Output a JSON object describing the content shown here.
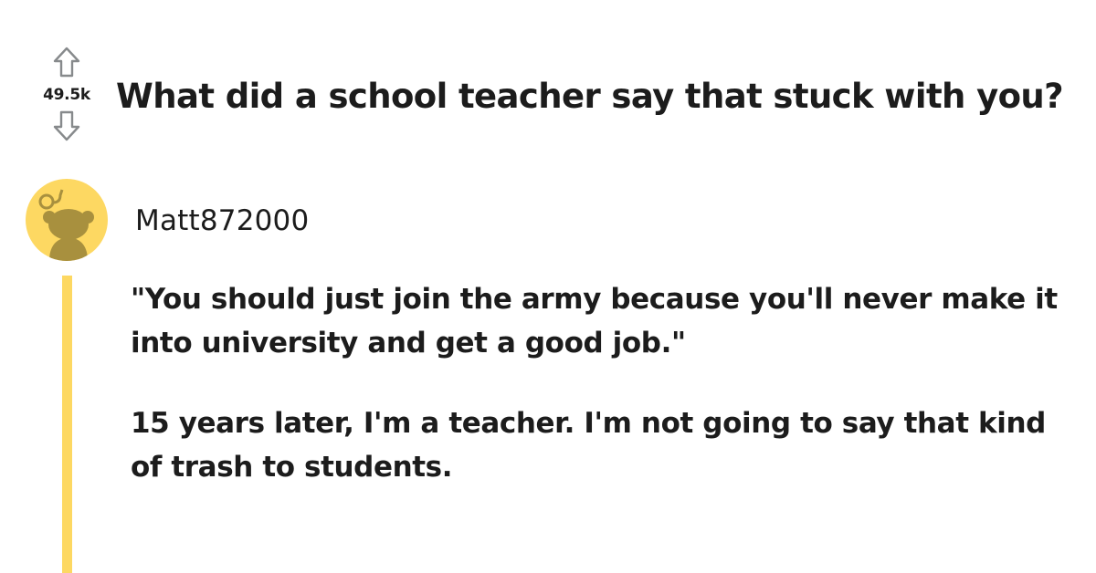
{
  "post": {
    "vote_count": "49.5k",
    "title": "What did a school teacher say that stuck with you?"
  },
  "comment": {
    "username": "Matt872000",
    "paragraphs": [
      "\"You should just join the army because you'll never make it into university and get a good job.\"",
      "15 years later, I'm a teacher. I'm not going to say that kind of trash to students."
    ]
  },
  "icons": {
    "upvote": "arrow-up-outline-icon",
    "downvote": "arrow-down-outline-icon",
    "avatar": "snoo-avatar-icon"
  },
  "colors": {
    "avatar_background": "#fdd862",
    "thread_line": "#fdd862",
    "snoo_silhouette": "#a8903e",
    "text": "#1c1c1c",
    "arrow": "#878a8c"
  }
}
